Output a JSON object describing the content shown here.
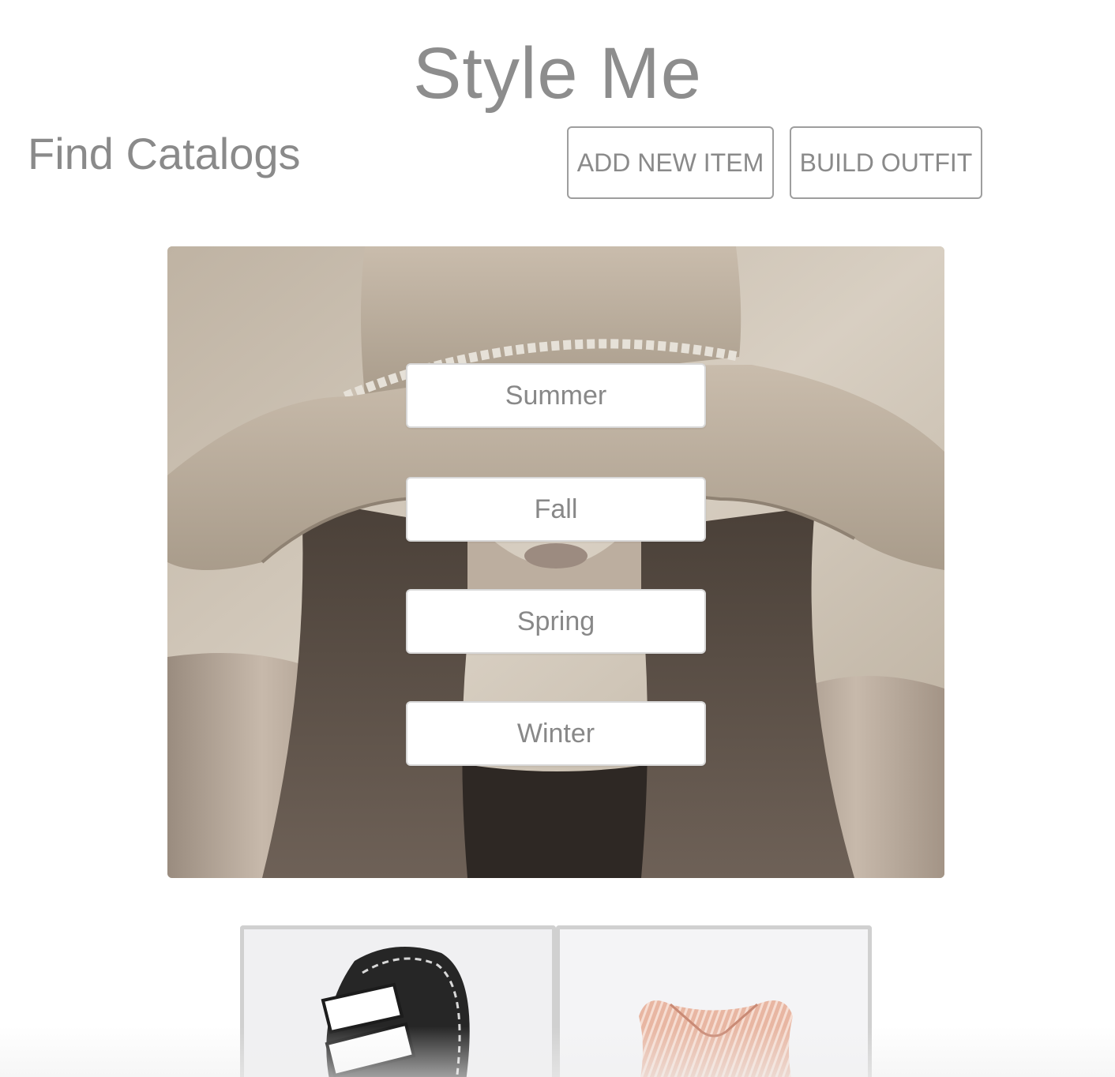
{
  "header": {
    "title": "Style Me",
    "section_heading": "Find Catalogs",
    "add_item_label": "ADD NEW ITEM",
    "build_outfit_label": "BUILD OUTFIT"
  },
  "catalogs": {
    "seasons": [
      "Summer",
      "Fall",
      "Spring",
      "Winter"
    ]
  },
  "colors": {
    "text": "#8a8a8a",
    "border": "#9e9e9e",
    "card_border": "#d0d0d0"
  }
}
